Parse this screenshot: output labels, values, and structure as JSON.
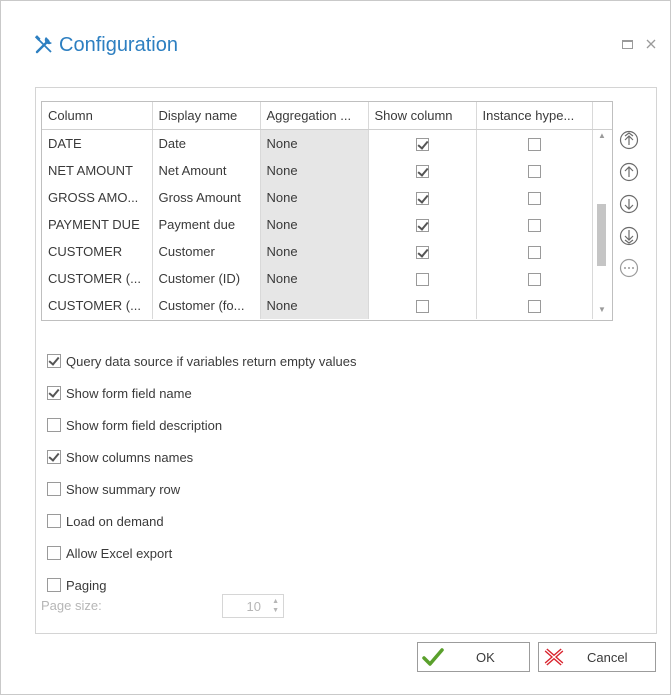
{
  "window": {
    "title": "Configuration"
  },
  "grid": {
    "headers": [
      "Column",
      "Display name",
      "Aggregation ...",
      "Show column",
      "Instance hype..."
    ],
    "rows": [
      {
        "column": "DATE",
        "display": "Date",
        "agg": "None",
        "show": true,
        "instance": false
      },
      {
        "column": "NET AMOUNT",
        "display": "Net Amount",
        "agg": "None",
        "show": true,
        "instance": false
      },
      {
        "column": "GROSS AMO...",
        "display": "Gross Amount",
        "agg": "None",
        "show": true,
        "instance": false
      },
      {
        "column": "PAYMENT DUE",
        "display": "Payment due",
        "agg": "None",
        "show": true,
        "instance": false
      },
      {
        "column": "CUSTOMER",
        "display": "Customer",
        "agg": "None",
        "show": true,
        "instance": false
      },
      {
        "column": "CUSTOMER (...",
        "display": "Customer (ID)",
        "agg": "None",
        "show": false,
        "instance": false
      },
      {
        "column": "CUSTOMER (...",
        "display": "Customer (fo...",
        "agg": "None",
        "show": false,
        "instance": false
      }
    ]
  },
  "side_buttons": [
    "move-top-icon",
    "move-up-icon",
    "move-down-icon",
    "move-bottom-icon",
    "more-icon"
  ],
  "options": [
    {
      "label": "Query data source if variables return empty values",
      "checked": true
    },
    {
      "label": "Show form field name",
      "checked": true
    },
    {
      "label": "Show form field description",
      "checked": false
    },
    {
      "label": "Show columns names",
      "checked": true
    },
    {
      "label": "Show summary row",
      "checked": false
    },
    {
      "label": "Load on demand",
      "checked": false
    },
    {
      "label": "Allow Excel export",
      "checked": false
    },
    {
      "label": "Paging",
      "checked": false
    }
  ],
  "page_size": {
    "label": "Page size:",
    "value": "10"
  },
  "buttons": {
    "ok": "OK",
    "cancel": "Cancel"
  },
  "colors": {
    "accent": "#2d7fc1",
    "ok_icon": "#5aa02c",
    "cancel_icon": "#d9232d"
  }
}
